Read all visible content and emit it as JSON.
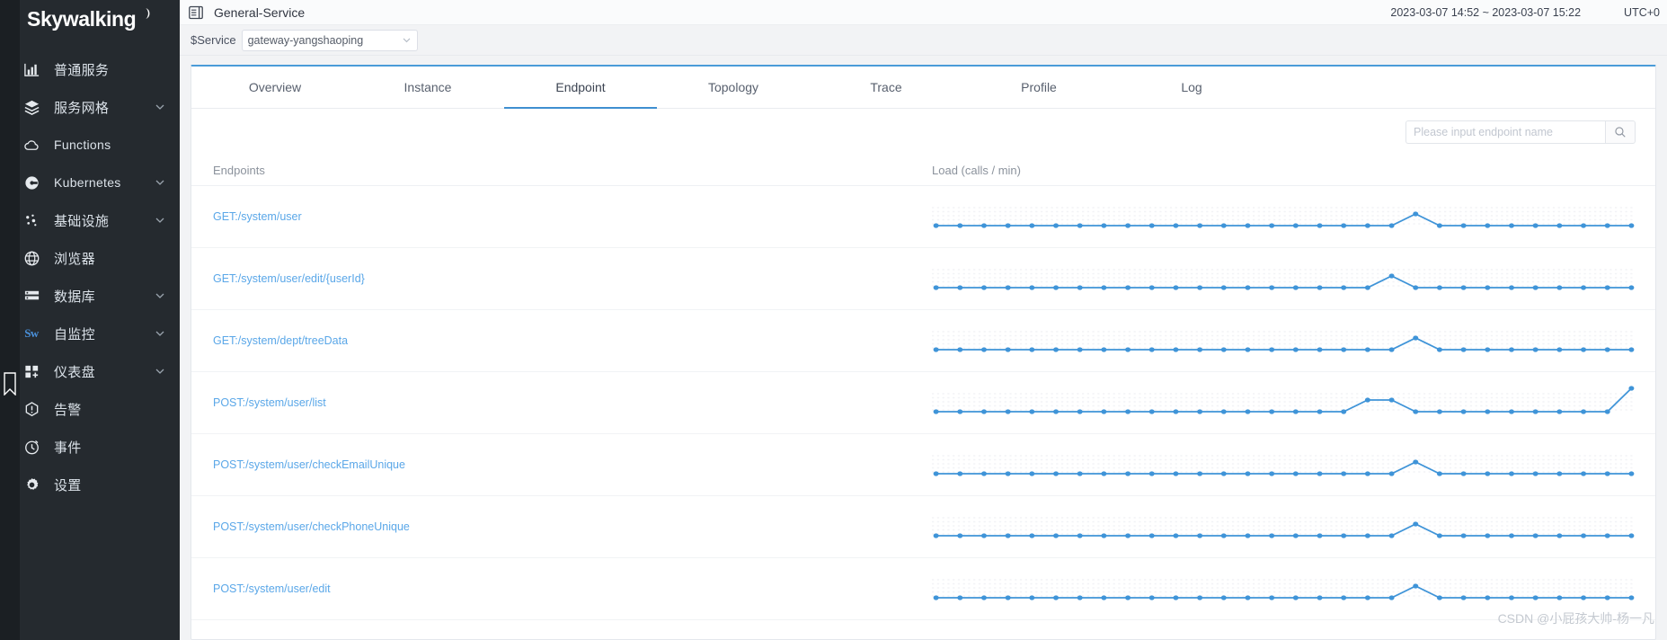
{
  "sidebar": {
    "logo": "Skywalking",
    "items": [
      {
        "label": "普通服务",
        "icon": "chart-bar-icon",
        "expandable": false
      },
      {
        "label": "服务网格",
        "icon": "layers-icon",
        "expandable": true
      },
      {
        "label": "Functions",
        "icon": "cloud-icon",
        "expandable": false
      },
      {
        "label": "Kubernetes",
        "icon": "kubernetes-icon",
        "expandable": true
      },
      {
        "label": "基础设施",
        "icon": "nodes-icon",
        "expandable": true
      },
      {
        "label": "浏览器",
        "icon": "globe-icon",
        "expandable": false
      },
      {
        "label": "数据库",
        "icon": "database-icon",
        "expandable": true
      },
      {
        "label": "自监控",
        "icon": "sw-logo-icon",
        "expandable": true
      },
      {
        "label": "仪表盘",
        "icon": "dashboard-add-icon",
        "expandable": true
      },
      {
        "label": "告警",
        "icon": "alarm-icon",
        "expandable": false
      },
      {
        "label": "事件",
        "icon": "event-clock-icon",
        "expandable": false
      },
      {
        "label": "设置",
        "icon": "gear-icon",
        "expandable": false
      }
    ]
  },
  "topbar": {
    "menu_icon": "panel-collapse-icon",
    "title": "General-Service",
    "time_range": "2023-03-07 14:52 ~ 2023-03-07 15:22",
    "timezone": "UTC+0"
  },
  "filterbar": {
    "label": "$Service",
    "selected": "gateway-yangshaoping",
    "caret_icon": "chevron-down-icon"
  },
  "tabs": [
    {
      "label": "Overview",
      "active": false
    },
    {
      "label": "Instance",
      "active": false
    },
    {
      "label": "Endpoint",
      "active": true
    },
    {
      "label": "Topology",
      "active": false
    },
    {
      "label": "Trace",
      "active": false
    },
    {
      "label": "Profile",
      "active": false
    },
    {
      "label": "Log",
      "active": false
    }
  ],
  "search": {
    "placeholder": "Please input endpoint name",
    "value": "",
    "button_icon": "search-icon"
  },
  "table": {
    "columns": [
      "Endpoints",
      "Load (calls / min)"
    ],
    "rows": [
      {
        "endpoint": "GET:/system/user"
      },
      {
        "endpoint": "GET:/system/user/edit/{userId}"
      },
      {
        "endpoint": "GET:/system/dept/treeData"
      },
      {
        "endpoint": "POST:/system/user/list"
      },
      {
        "endpoint": "POST:/system/user/checkEmailUnique"
      },
      {
        "endpoint": "POST:/system/user/checkPhoneUnique"
      },
      {
        "endpoint": "POST:/system/user/edit"
      }
    ]
  },
  "colors": {
    "line": "#3f94d8",
    "link": "#5aa7e8",
    "accent": "#3f8fd0",
    "sidebar_bg": "#252a2f",
    "rail_bg": "#1b1f23"
  },
  "chart_data": [
    {
      "type": "line",
      "title": "GET:/system/user",
      "ylabel": "Load (calls / min)",
      "xlabel": "",
      "grid": true,
      "legend": "none",
      "ylim": [
        0,
        4
      ],
      "x": [
        0,
        1,
        2,
        3,
        4,
        5,
        6,
        7,
        8,
        9,
        10,
        11,
        12,
        13,
        14,
        15,
        16,
        17,
        18,
        19,
        20,
        21,
        22,
        23,
        24,
        25,
        26,
        27,
        28,
        29
      ],
      "values": [
        1,
        1,
        1,
        1,
        1,
        1,
        1,
        1,
        1,
        1,
        1,
        1,
        1,
        1,
        1,
        1,
        1,
        1,
        1,
        1,
        2,
        1,
        1,
        1,
        1,
        1,
        1,
        1,
        1,
        1
      ]
    },
    {
      "type": "line",
      "title": "GET:/system/user/edit/{userId}",
      "ylabel": "Load (calls / min)",
      "xlabel": "",
      "grid": true,
      "legend": "none",
      "ylim": [
        0,
        4
      ],
      "x": [
        0,
        1,
        2,
        3,
        4,
        5,
        6,
        7,
        8,
        9,
        10,
        11,
        12,
        13,
        14,
        15,
        16,
        17,
        18,
        19,
        20,
        21,
        22,
        23,
        24,
        25,
        26,
        27,
        28,
        29
      ],
      "values": [
        1,
        1,
        1,
        1,
        1,
        1,
        1,
        1,
        1,
        1,
        1,
        1,
        1,
        1,
        1,
        1,
        1,
        1,
        1,
        2,
        1,
        1,
        1,
        1,
        1,
        1,
        1,
        1,
        1,
        1
      ]
    },
    {
      "type": "line",
      "title": "GET:/system/dept/treeData",
      "ylabel": "Load (calls / min)",
      "xlabel": "",
      "grid": true,
      "legend": "none",
      "ylim": [
        0,
        4
      ],
      "x": [
        0,
        1,
        2,
        3,
        4,
        5,
        6,
        7,
        8,
        9,
        10,
        11,
        12,
        13,
        14,
        15,
        16,
        17,
        18,
        19,
        20,
        21,
        22,
        23,
        24,
        25,
        26,
        27,
        28,
        29
      ],
      "values": [
        1,
        1,
        1,
        1,
        1,
        1,
        1,
        1,
        1,
        1,
        1,
        1,
        1,
        1,
        1,
        1,
        1,
        1,
        1,
        1,
        2,
        1,
        1,
        1,
        1,
        1,
        1,
        1,
        1,
        1
      ]
    },
    {
      "type": "line",
      "title": "POST:/system/user/list",
      "ylabel": "Load (calls / min)",
      "xlabel": "",
      "grid": true,
      "legend": "none",
      "ylim": [
        0,
        4
      ],
      "x": [
        0,
        1,
        2,
        3,
        4,
        5,
        6,
        7,
        8,
        9,
        10,
        11,
        12,
        13,
        14,
        15,
        16,
        17,
        18,
        19,
        20,
        21,
        22,
        23,
        24,
        25,
        26,
        27,
        28,
        29
      ],
      "values": [
        1,
        1,
        1,
        1,
        1,
        1,
        1,
        1,
        1,
        1,
        1,
        1,
        1,
        1,
        1,
        1,
        1,
        1,
        2,
        2,
        1,
        1,
        1,
        1,
        1,
        1,
        1,
        1,
        1,
        3
      ]
    },
    {
      "type": "line",
      "title": "POST:/system/user/checkEmailUnique",
      "ylabel": "Load (calls / min)",
      "xlabel": "",
      "grid": true,
      "legend": "none",
      "ylim": [
        0,
        4
      ],
      "x": [
        0,
        1,
        2,
        3,
        4,
        5,
        6,
        7,
        8,
        9,
        10,
        11,
        12,
        13,
        14,
        15,
        16,
        17,
        18,
        19,
        20,
        21,
        22,
        23,
        24,
        25,
        26,
        27,
        28,
        29
      ],
      "values": [
        1,
        1,
        1,
        1,
        1,
        1,
        1,
        1,
        1,
        1,
        1,
        1,
        1,
        1,
        1,
        1,
        1,
        1,
        1,
        1,
        2,
        1,
        1,
        1,
        1,
        1,
        1,
        1,
        1,
        1
      ]
    },
    {
      "type": "line",
      "title": "POST:/system/user/checkPhoneUnique",
      "ylabel": "Load (calls / min)",
      "xlabel": "",
      "grid": true,
      "legend": "none",
      "ylim": [
        0,
        4
      ],
      "x": [
        0,
        1,
        2,
        3,
        4,
        5,
        6,
        7,
        8,
        9,
        10,
        11,
        12,
        13,
        14,
        15,
        16,
        17,
        18,
        19,
        20,
        21,
        22,
        23,
        24,
        25,
        26,
        27,
        28,
        29
      ],
      "values": [
        1,
        1,
        1,
        1,
        1,
        1,
        1,
        1,
        1,
        1,
        1,
        1,
        1,
        1,
        1,
        1,
        1,
        1,
        1,
        1,
        2,
        1,
        1,
        1,
        1,
        1,
        1,
        1,
        1,
        1
      ]
    },
    {
      "type": "line",
      "title": "POST:/system/user/edit",
      "ylabel": "Load (calls / min)",
      "xlabel": "",
      "grid": true,
      "legend": "none",
      "ylim": [
        0,
        4
      ],
      "x": [
        0,
        1,
        2,
        3,
        4,
        5,
        6,
        7,
        8,
        9,
        10,
        11,
        12,
        13,
        14,
        15,
        16,
        17,
        18,
        19,
        20,
        21,
        22,
        23,
        24,
        25,
        26,
        27,
        28,
        29
      ],
      "values": [
        1,
        1,
        1,
        1,
        1,
        1,
        1,
        1,
        1,
        1,
        1,
        1,
        1,
        1,
        1,
        1,
        1,
        1,
        1,
        1,
        2,
        1,
        1,
        1,
        1,
        1,
        1,
        1,
        1,
        1
      ]
    }
  ],
  "watermark": "CSDN @小屁孩大帅-杨一凡"
}
